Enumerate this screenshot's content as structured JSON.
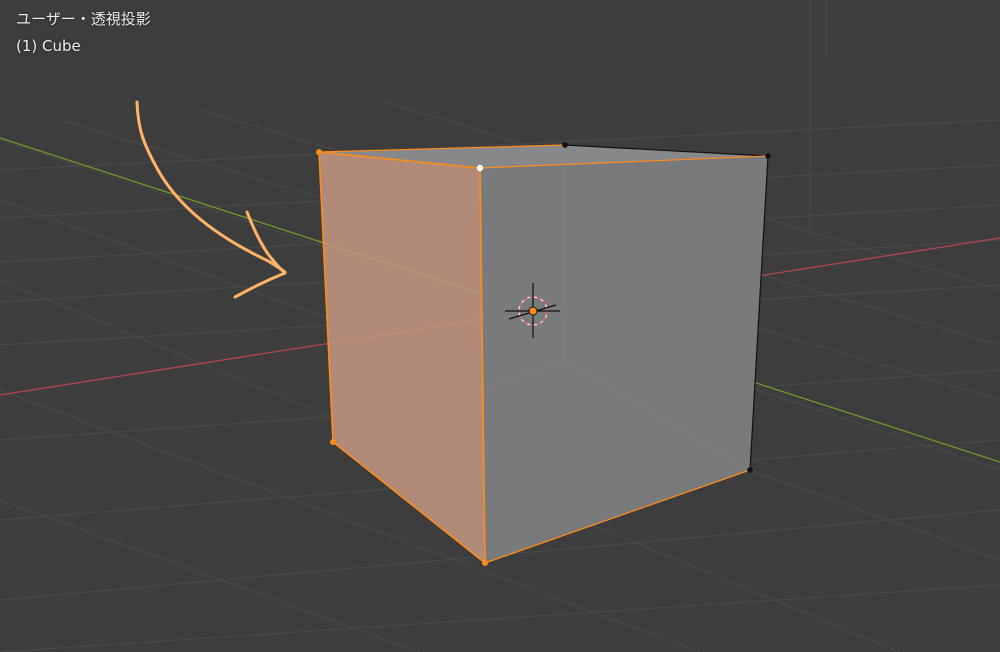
{
  "viewport": {
    "view_name": "ユーザー・透視投影",
    "object_info": "(1) Cube"
  },
  "colors": {
    "background": "#3d3d3d",
    "grid_line": "#4a4a4a",
    "x_axis": "#b5454f",
    "y_axis": "#6f9a2a",
    "selected_face": "#c79a82",
    "mesh_face": "#7b7c7e",
    "selection_edge": "#ff8c1a",
    "annotation_stroke": "#ffb366",
    "active_vertex": "#ffffff",
    "unselected_vertex": "#000000"
  },
  "icons": {
    "origin": "object-origin-icon",
    "cursor": "3d-cursor-icon",
    "annotation": "hand-drawn-arrow-icon"
  }
}
